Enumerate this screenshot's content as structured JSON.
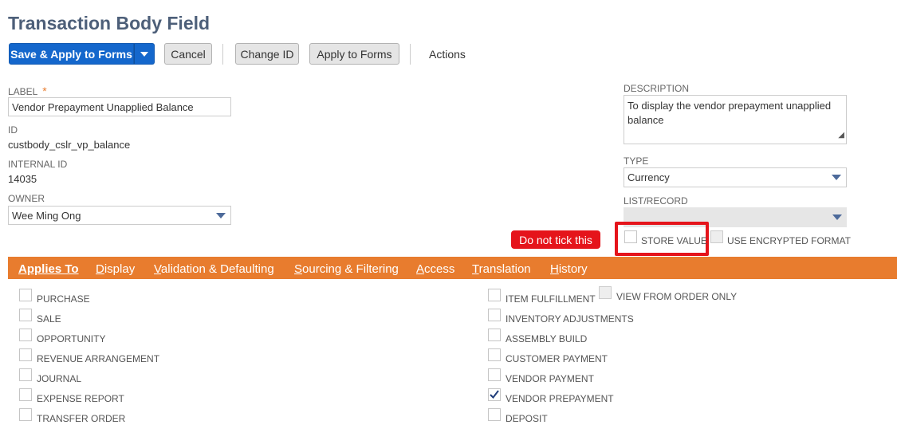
{
  "page": {
    "title": "Transaction Body Field"
  },
  "toolbar": {
    "save_label": "Save & Apply to Forms",
    "cancel_label": "Cancel",
    "change_id_label": "Change ID",
    "apply_label": "Apply to Forms",
    "actions_label": "Actions"
  },
  "fields": {
    "label_title": "LABEL",
    "label_required": "*",
    "label_value": "Vendor Prepayment Unapplied Balance",
    "id_title": "ID",
    "id_value": "custbody_cslr_vp_balance",
    "internal_id_title": "INTERNAL ID",
    "internal_id_value": "14035",
    "owner_title": "OWNER",
    "owner_value": "Wee Ming Ong",
    "description_title": "DESCRIPTION",
    "description_value": "To display the vendor prepayment unapplied balance",
    "type_title": "TYPE",
    "type_value": "Currency",
    "listrecord_title": "LIST/RECORD",
    "store_value_label": "STORE VALUE",
    "encrypted_label": "USE ENCRYPTED FORMAT"
  },
  "annotation": {
    "text": "Do not tick this",
    "color": "#e5141b"
  },
  "tabs": [
    {
      "pre": "",
      "ul": "Applies To",
      "post": ""
    },
    {
      "pre": "",
      "ul": "D",
      "post": "isplay"
    },
    {
      "pre": "",
      "ul": "V",
      "post": "alidation & Defaulting"
    },
    {
      "pre": "",
      "ul": "S",
      "post": "ourcing & Filtering"
    },
    {
      "pre": "",
      "ul": "A",
      "post": "ccess"
    },
    {
      "pre": "",
      "ul": "T",
      "post": "ranslation"
    },
    {
      "pre": "",
      "ul": "H",
      "post": "istory"
    }
  ],
  "applies_left": [
    {
      "label": "PURCHASE",
      "checked": false
    },
    {
      "label": "SALE",
      "checked": false
    },
    {
      "label": "OPPORTUNITY",
      "checked": false
    },
    {
      "label": "REVENUE ARRANGEMENT",
      "checked": false
    },
    {
      "label": "JOURNAL",
      "checked": false
    },
    {
      "label": "EXPENSE REPORT",
      "checked": false
    },
    {
      "label": "TRANSFER ORDER",
      "checked": false
    }
  ],
  "applies_right": [
    {
      "label": "ITEM FULFILLMENT",
      "checked": false
    },
    {
      "label": "INVENTORY ADJUSTMENTS",
      "checked": false
    },
    {
      "label": "ASSEMBLY BUILD",
      "checked": false
    },
    {
      "label": "CUSTOMER PAYMENT",
      "checked": false
    },
    {
      "label": "VENDOR PAYMENT",
      "checked": false
    },
    {
      "label": "VENDOR PREPAYMENT",
      "checked": true
    },
    {
      "label": "DEPOSIT",
      "checked": false
    }
  ],
  "view_from_order_only": "VIEW FROM ORDER ONLY",
  "colors": {
    "primary": "#1467cc",
    "tabbar": "#e87c2e",
    "title": "#4d5f79",
    "highlight": "#e5141b"
  }
}
